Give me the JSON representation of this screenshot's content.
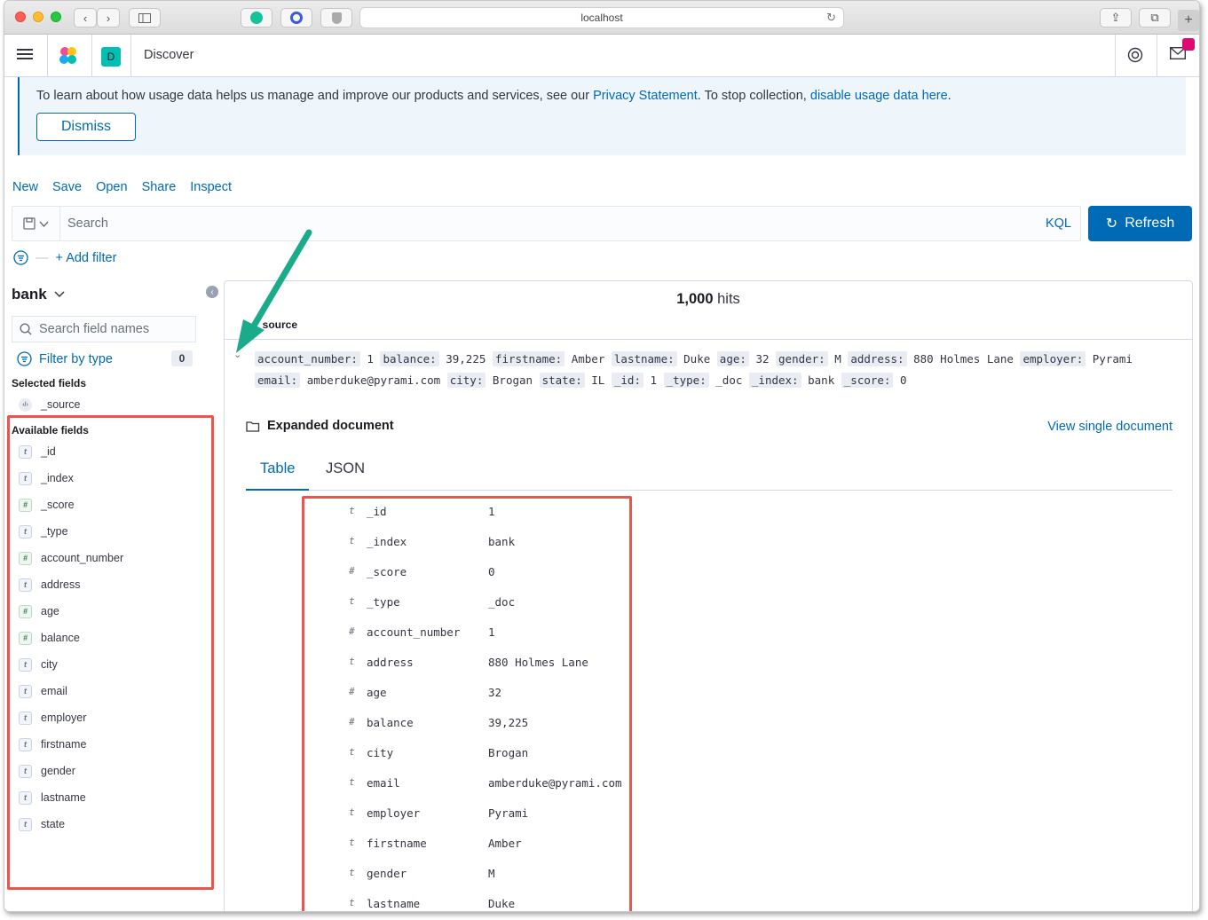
{
  "browser": {
    "url": "localhost"
  },
  "header": {
    "space_letter": "D",
    "app_title": "Discover"
  },
  "callout": {
    "text_before": "To learn about how usage data helps us manage and improve our products and services, see our ",
    "privacy_link": "Privacy Statement",
    "text_middle": ". To stop collection, ",
    "disable_link": "disable usage data here",
    "text_after": ".",
    "dismiss_label": "Dismiss"
  },
  "top_nav": {
    "new": "New",
    "save": "Save",
    "open": "Open",
    "share": "Share",
    "inspect": "Inspect"
  },
  "query": {
    "placeholder": "Search",
    "language": "KQL",
    "refresh_label": "Refresh",
    "add_filter": "+ Add filter"
  },
  "sidebar": {
    "index_pattern": "bank",
    "search_placeholder": "Search field names",
    "filter_by_type": "Filter by type",
    "filter_count": "0",
    "selected_label": "Selected fields",
    "selected_fields": [
      {
        "type": "source",
        "name": "_source"
      }
    ],
    "available_label": "Available fields",
    "available_fields": [
      {
        "type": "t",
        "name": "_id"
      },
      {
        "type": "t",
        "name": "_index"
      },
      {
        "type": "#",
        "name": "_score"
      },
      {
        "type": "t",
        "name": "_type"
      },
      {
        "type": "#",
        "name": "account_number"
      },
      {
        "type": "t",
        "name": "address"
      },
      {
        "type": "#",
        "name": "age"
      },
      {
        "type": "#",
        "name": "balance"
      },
      {
        "type": "t",
        "name": "city"
      },
      {
        "type": "t",
        "name": "email"
      },
      {
        "type": "t",
        "name": "employer"
      },
      {
        "type": "t",
        "name": "firstname"
      },
      {
        "type": "t",
        "name": "gender"
      },
      {
        "type": "t",
        "name": "lastname"
      },
      {
        "type": "t",
        "name": "state"
      }
    ]
  },
  "results": {
    "hits_count": "1,000",
    "hits_label": " hits",
    "source_column": "_source",
    "source_line_1": [
      {
        "k": "account_number:",
        "v": "1"
      },
      {
        "k": "balance:",
        "v": "39,225"
      },
      {
        "k": "firstname:",
        "v": "Amber"
      },
      {
        "k": "lastname:",
        "v": "Duke"
      },
      {
        "k": "age:",
        "v": "32"
      },
      {
        "k": "gender:",
        "v": "M"
      },
      {
        "k": "address:",
        "v": "880 Holmes Lane"
      },
      {
        "k": "employer:",
        "v": "Pyrami"
      }
    ],
    "source_line_2": [
      {
        "k": "email:",
        "v": "amberduke@pyrami.com"
      },
      {
        "k": "city:",
        "v": "Brogan"
      },
      {
        "k": "state:",
        "v": "IL"
      },
      {
        "k": "_id:",
        "v": "1"
      },
      {
        "k": "_type:",
        "v": "_doc"
      },
      {
        "k": "_index:",
        "v": "bank"
      },
      {
        "k": "_score:",
        "v": "0"
      }
    ],
    "expanded_title": "Expanded document",
    "view_single": "View single document",
    "tab_table": "Table",
    "tab_json": "JSON",
    "doc_rows": [
      {
        "type": "t",
        "key": "_id",
        "value": "1"
      },
      {
        "type": "t",
        "key": "_index",
        "value": "bank"
      },
      {
        "type": "#",
        "key": "_score",
        "value": "0"
      },
      {
        "type": "t",
        "key": "_type",
        "value": "_doc"
      },
      {
        "type": "#",
        "key": "account_number",
        "value": "1"
      },
      {
        "type": "t",
        "key": "address",
        "value": "880 Holmes Lane"
      },
      {
        "type": "#",
        "key": "age",
        "value": "32"
      },
      {
        "type": "#",
        "key": "balance",
        "value": "39,225"
      },
      {
        "type": "t",
        "key": "city",
        "value": "Brogan"
      },
      {
        "type": "t",
        "key": "email",
        "value": "amberduke@pyrami.com"
      },
      {
        "type": "t",
        "key": "employer",
        "value": "Pyrami"
      },
      {
        "type": "t",
        "key": "firstname",
        "value": "Amber"
      },
      {
        "type": "t",
        "key": "gender",
        "value": "M"
      },
      {
        "type": "t",
        "key": "lastname",
        "value": "Duke"
      }
    ]
  },
  "colors": {
    "accent": "#006bb4",
    "highlight_box": "#e8574e",
    "arrow": "#1aab8a"
  }
}
